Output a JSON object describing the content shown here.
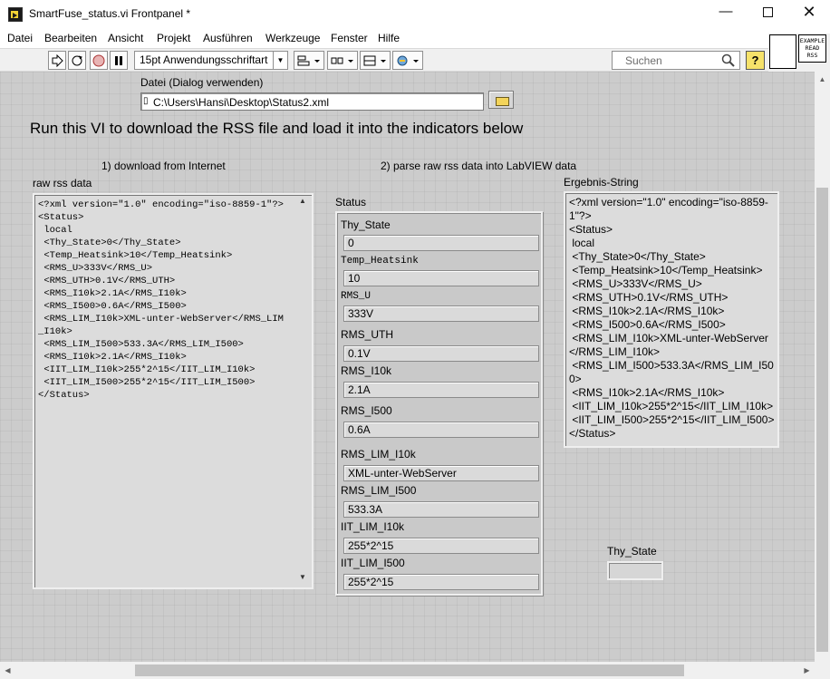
{
  "window": {
    "title": "SmartFuse_status.vi Frontpanel *",
    "minimize": "—",
    "close": "✕"
  },
  "menu": [
    "Datei",
    "Bearbeiten",
    "Ansicht",
    "Projekt",
    "Ausführen",
    "Werkzeuge",
    "Fenster",
    "Hilfe"
  ],
  "toolbar": {
    "font": "15pt Anwendungsschriftart",
    "search_placeholder": "Suchen",
    "help": "?"
  },
  "vi_icon": {
    "example_text": "EXAMPLE READ RSS"
  },
  "panel": {
    "path_label": "Datei (Dialog verwenden)",
    "path_value": "C:\\Users\\Hansi\\Desktop\\Status2.xml",
    "heading": "Run this VI to download the RSS file and load it into the indicators below",
    "step1": "1) download from Internet",
    "step2": "2) parse raw rss data into LabVIEW data",
    "raw_label": "raw rss data",
    "raw_text": "<?xml version=\"1.0\" encoding=\"iso-8859-1\"?>\n<Status>\n local\n <Thy_State>0</Thy_State>\n <Temp_Heatsink>10</Temp_Heatsink>\n <RMS_U>333V</RMS_U>\n <RMS_UTH>0.1V</RMS_UTH>\n <RMS_I10k>2.1A</RMS_I10k>\n <RMS_I500>0.6A</RMS_I500>\n <RMS_LIM_I10k>XML-unter-WebServer</RMS_LIM_I10k>\n <RMS_LIM_I500>533.3A</RMS_LIM_I500>\n <RMS_I10k>2.1A</RMS_I10k>\n <IIT_LIM_I10k>255*2^15</IIT_LIM_I10k>\n <IIT_LIM_I500>255*2^15</IIT_LIM_I500>\n</Status>",
    "status_label": "Status",
    "status_fields": [
      {
        "label": "Thy_State",
        "value": "0"
      },
      {
        "label": "Temp_Heatsink",
        "value": "10"
      },
      {
        "label": "RMS_U",
        "value": "333V"
      },
      {
        "label": "RMS_UTH",
        "value": "0.1V"
      },
      {
        "label": "RMS_I10k",
        "value": "2.1A"
      },
      {
        "label": "RMS_I500",
        "value": "0.6A"
      },
      {
        "label": "RMS_LIM_I10k",
        "value": "XML-unter-WebServer"
      },
      {
        "label": "RMS_LIM_I500",
        "value": "533.3A"
      },
      {
        "label": "IIT_LIM_I10k",
        "value": "255*2^15"
      },
      {
        "label": "IIT_LIM_I500",
        "value": "255*2^15"
      }
    ],
    "ergebnis_label": "Ergebnis-String",
    "ergebnis_text": "<?xml version=\"1.0\" encoding=\"iso-8859-1\"?>\n<Status>\n local\n <Thy_State>0</Thy_State>\n <Temp_Heatsink>10</Temp_Heatsink>\n <RMS_U>333V</RMS_U>\n <RMS_UTH>0.1V</RMS_UTH>\n <RMS_I10k>2.1A</RMS_I10k>\n <RMS_I500>0.6A</RMS_I500>\n <RMS_LIM_I10k>XML-unter-WebServer</RMS_LIM_I10k>\n <RMS_LIM_I500>533.3A</RMS_LIM_I500>\n <RMS_I10k>2.1A</RMS_I10k>\n <IIT_LIM_I10k>255*2^15</IIT_LIM_I10k>\n <IIT_LIM_I500>255*2^15</IIT_LIM_I500>\n</Status>",
    "thy_state_label": "Thy_State"
  }
}
